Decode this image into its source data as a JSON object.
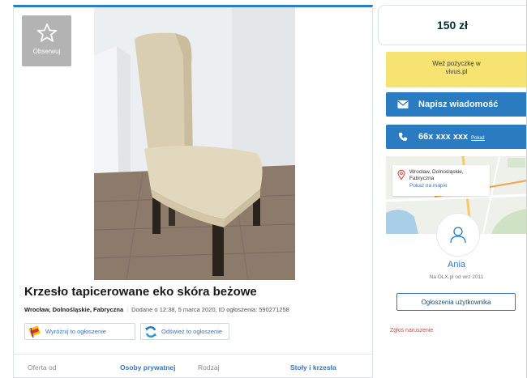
{
  "observe": {
    "label": "Obserwuj",
    "icon": "star-icon"
  },
  "listing": {
    "title": "Krzesło tapicerowane eko skóra beżowe",
    "location": "Wrocław, Dolnośląskie, Fabryczna",
    "added": "Dodane o 12:38, 5 marca 2020, ID ogłoszenia: 590271258"
  },
  "promos": [
    {
      "label": "Wyróżnij to ogłoszenie",
      "icon": "highlight-ribbon-icon"
    },
    {
      "label": "Odśwież to ogłoszenie",
      "icon": "refresh-icon"
    }
  ],
  "attributes": [
    {
      "key": "Oferta od",
      "value": "Osoby prywatnej"
    },
    {
      "key": "Rodzaj",
      "value": "Stoły i krzesła"
    }
  ],
  "sidebar": {
    "price": "150 zł",
    "loan_line1": "Weź pożyczkę w",
    "loan_line2": "vivus.pl",
    "message_label": "Napisz wiadomość",
    "phone_number": "66x xxx xxx",
    "phone_show": "Pokaż",
    "address_line1": "Wrocław, Dolnośląskie,",
    "address_line2": "Fabryczna",
    "map_link": "Pokaż na mapie",
    "user_name": "Ania",
    "user_since": "Na OLX.pl od wrz 2011",
    "user_ads_label": "Ogłoszenia użytkownika",
    "report_label": "Zgłoś naruszenie"
  },
  "colors": {
    "accent": "#2a7bbf",
    "loan_bg": "#f7e371",
    "report": "#d64a3e"
  }
}
